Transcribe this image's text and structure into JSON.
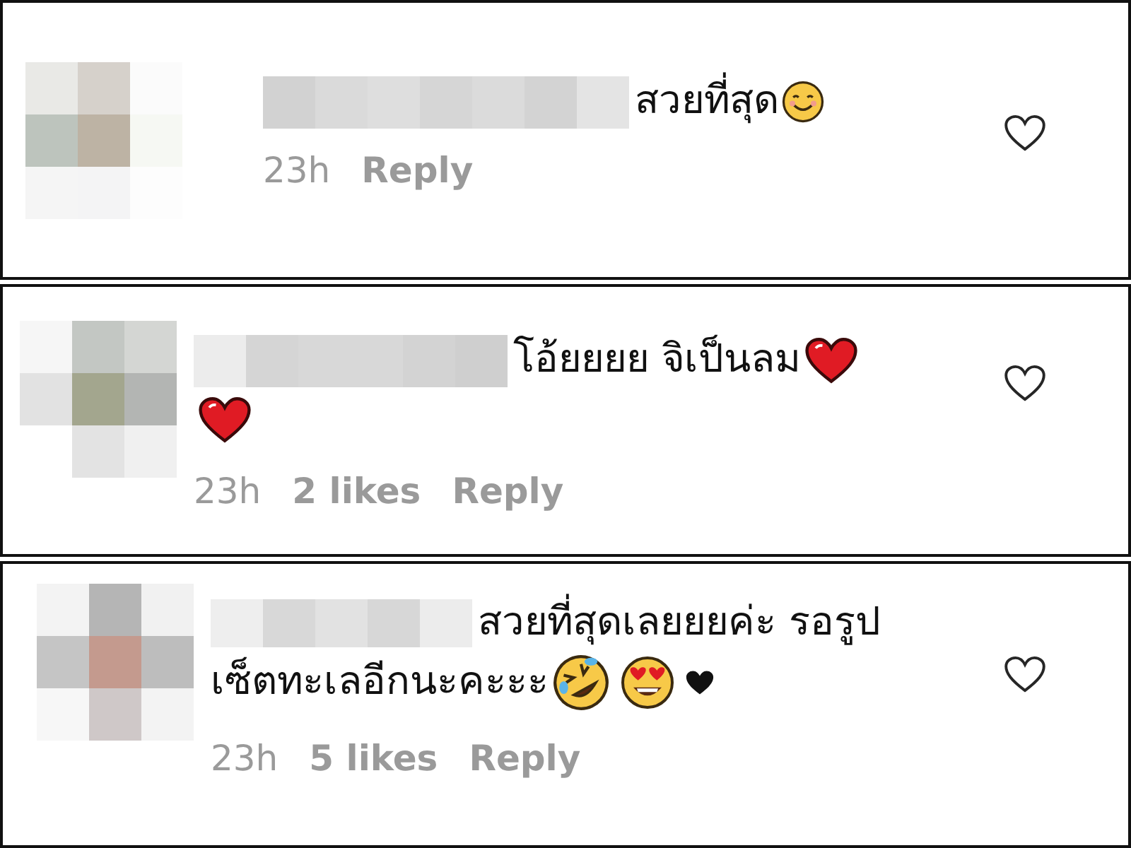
{
  "comments": [
    {
      "lines": [
        [
          {
            "kind": "text",
            "text": "สวยที่สุด"
          },
          {
            "kind": "smile-emoji"
          }
        ]
      ],
      "time": "23h",
      "reply": "Reply"
    },
    {
      "lines": [
        [
          {
            "kind": "text",
            "text": "โอ้ยยยย จิเป็นลม"
          },
          {
            "kind": "red-heart-emoji"
          }
        ],
        [
          {
            "kind": "red-heart-emoji"
          }
        ]
      ],
      "time": "23h",
      "likes": "2 likes",
      "reply": "Reply"
    },
    {
      "lines": [
        [
          {
            "kind": "text",
            "text": "สวยที่สุดเลยยยค่ะ รอรูป"
          }
        ],
        [
          {
            "kind": "text",
            "text": "เซ็ตทะเลอีกนะคะะะ"
          },
          {
            "kind": "laughing-emoji"
          },
          {
            "kind": "heart-eyes-emoji"
          },
          {
            "kind": "black-heart"
          }
        ]
      ],
      "time": "23h",
      "likes": "5 likes",
      "reply": "Reply"
    }
  ]
}
